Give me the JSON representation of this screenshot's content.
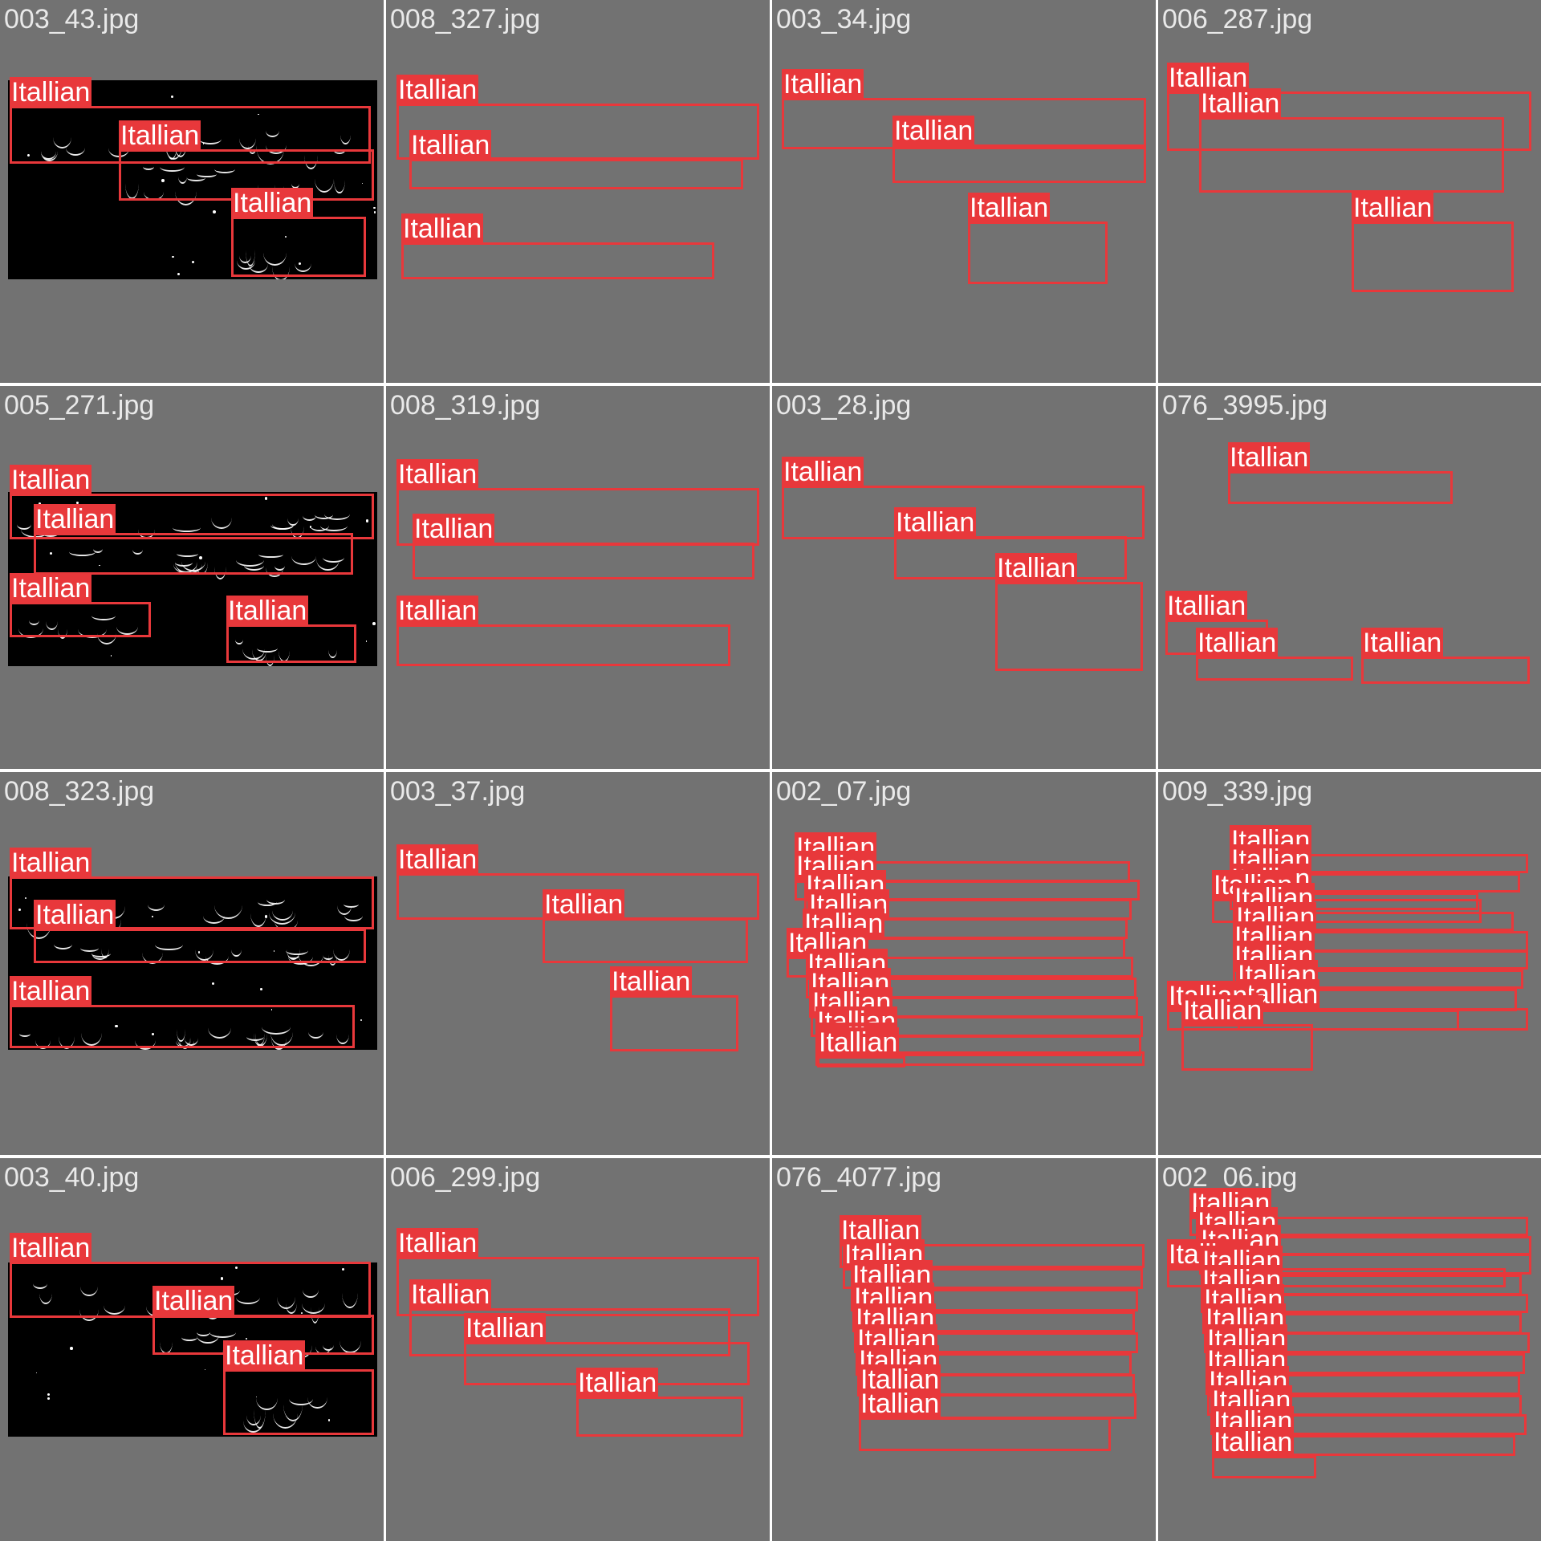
{
  "colors": {
    "tile_background": "#727272",
    "document_background": "#000000",
    "box_color": "#e8383b",
    "label_text": "#ffffff",
    "filename_text": "#e9e9e9"
  },
  "label": "Itallian",
  "tiles": [
    {
      "filename": "003_43.jpg",
      "box_count": 3
    },
    {
      "filename": "008_327.jpg",
      "box_count": 3
    },
    {
      "filename": "003_34.jpg",
      "box_count": 3
    },
    {
      "filename": "006_287.jpg",
      "box_count": 3
    },
    {
      "filename": "005_271.jpg",
      "box_count": 4
    },
    {
      "filename": "008_319.jpg",
      "box_count": 3
    },
    {
      "filename": "003_28.jpg",
      "box_count": 3
    },
    {
      "filename": "076_3995.jpg",
      "box_count": 4
    },
    {
      "filename": "008_323.jpg",
      "box_count": 3
    },
    {
      "filename": "003_37.jpg",
      "box_count": 3
    },
    {
      "filename": "002_07.jpg",
      "box_count": 12
    },
    {
      "filename": "009_339.jpg",
      "box_count": 12
    },
    {
      "filename": "003_40.jpg",
      "box_count": 3
    },
    {
      "filename": "006_299.jpg",
      "box_count": 4
    },
    {
      "filename": "076_4077.jpg",
      "box_count": 9
    },
    {
      "filename": "002_06.jpg",
      "box_count": 14
    }
  ]
}
